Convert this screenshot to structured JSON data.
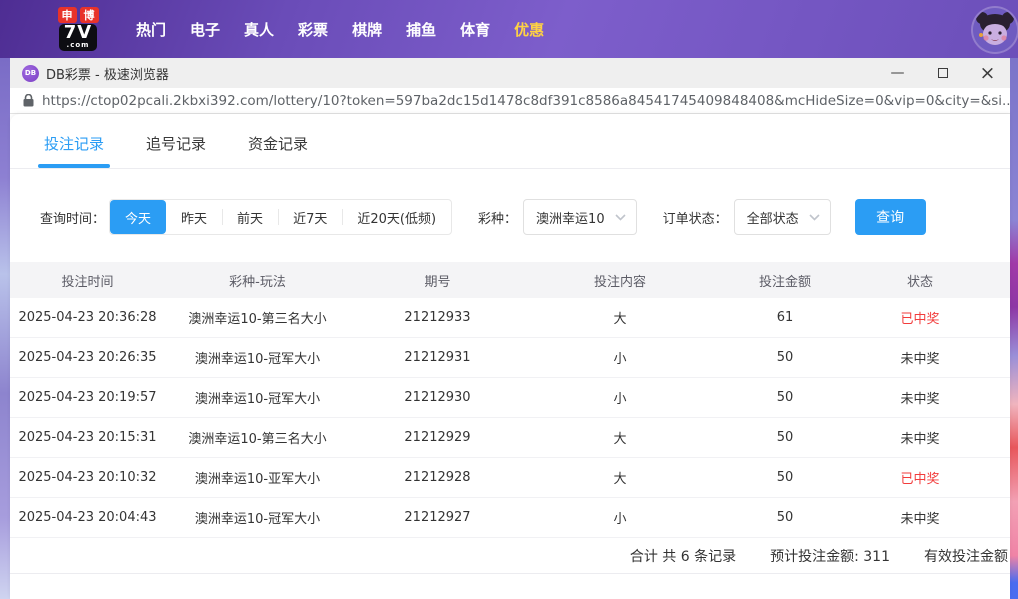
{
  "site_nav": {
    "logo": {
      "badge1": "申",
      "badge2": "博",
      "main": "7V",
      "sub": ".com"
    },
    "items": [
      {
        "label": "热门"
      },
      {
        "label": "电子"
      },
      {
        "label": "真人"
      },
      {
        "label": "彩票"
      },
      {
        "label": "棋牌"
      },
      {
        "label": "捕鱼"
      },
      {
        "label": "体育"
      },
      {
        "label": "优惠"
      }
    ]
  },
  "browser": {
    "favicon_text": "DB",
    "window_title": "DB彩票 - 极速浏览器",
    "minimize_glyph": "—",
    "close_glyph": "×",
    "url": "https://ctop02pcali.2kbxi392.com/lottery/10?token=597ba2dc15d1478c8df391c8586a84541745409848408&mcHideSize=0&vip=0&city=&si..."
  },
  "tabs": [
    {
      "label": "投注记录",
      "active": true
    },
    {
      "label": "追号记录",
      "active": false
    },
    {
      "label": "资金记录",
      "active": false
    }
  ],
  "filters": {
    "time_label": "查询时间：",
    "time_options": [
      {
        "label": "今天",
        "active": true
      },
      {
        "label": "昨天",
        "active": false
      },
      {
        "label": "前天",
        "active": false
      },
      {
        "label": "近7天",
        "active": false
      },
      {
        "label": "近20天(低频)",
        "active": false
      }
    ],
    "lottery_label": "彩种：",
    "lottery_value": "澳洲幸运10",
    "status_label": "订单状态：",
    "status_value": "全部状态",
    "search_button": "查询"
  },
  "table": {
    "headers": [
      "投注时间",
      "彩种-玩法",
      "期号",
      "投注内容",
      "投注金额",
      "状态"
    ],
    "rows": [
      {
        "time": "2025-04-23 20:36:28",
        "game": "澳洲幸运10-第三名大小",
        "issue": "21212933",
        "content": "大",
        "amount": "61",
        "status": "已中奖",
        "won": true
      },
      {
        "time": "2025-04-23 20:26:35",
        "game": "澳洲幸运10-冠军大小",
        "issue": "21212931",
        "content": "小",
        "amount": "50",
        "status": "未中奖",
        "won": false
      },
      {
        "time": "2025-04-23 20:19:57",
        "game": "澳洲幸运10-冠军大小",
        "issue": "21212930",
        "content": "小",
        "amount": "50",
        "status": "未中奖",
        "won": false
      },
      {
        "time": "2025-04-23 20:15:31",
        "game": "澳洲幸运10-第三名大小",
        "issue": "21212929",
        "content": "大",
        "amount": "50",
        "status": "未中奖",
        "won": false
      },
      {
        "time": "2025-04-23 20:10:32",
        "game": "澳洲幸运10-亚军大小",
        "issue": "21212928",
        "content": "大",
        "amount": "50",
        "status": "已中奖",
        "won": true
      },
      {
        "time": "2025-04-23 20:04:43",
        "game": "澳洲幸运10-冠军大小",
        "issue": "21212927",
        "content": "小",
        "amount": "50",
        "status": "未中奖",
        "won": false
      }
    ],
    "summary": {
      "total": "合计 共 6 条记录",
      "estimated": "预计投注金额: 311",
      "valid": "有效投注金额"
    }
  },
  "colors": {
    "accent": "#2b9df4",
    "won_status": "#f23b3b",
    "nav_highlight": "#ffd243",
    "topbar_purple": "#6a4cb8"
  }
}
